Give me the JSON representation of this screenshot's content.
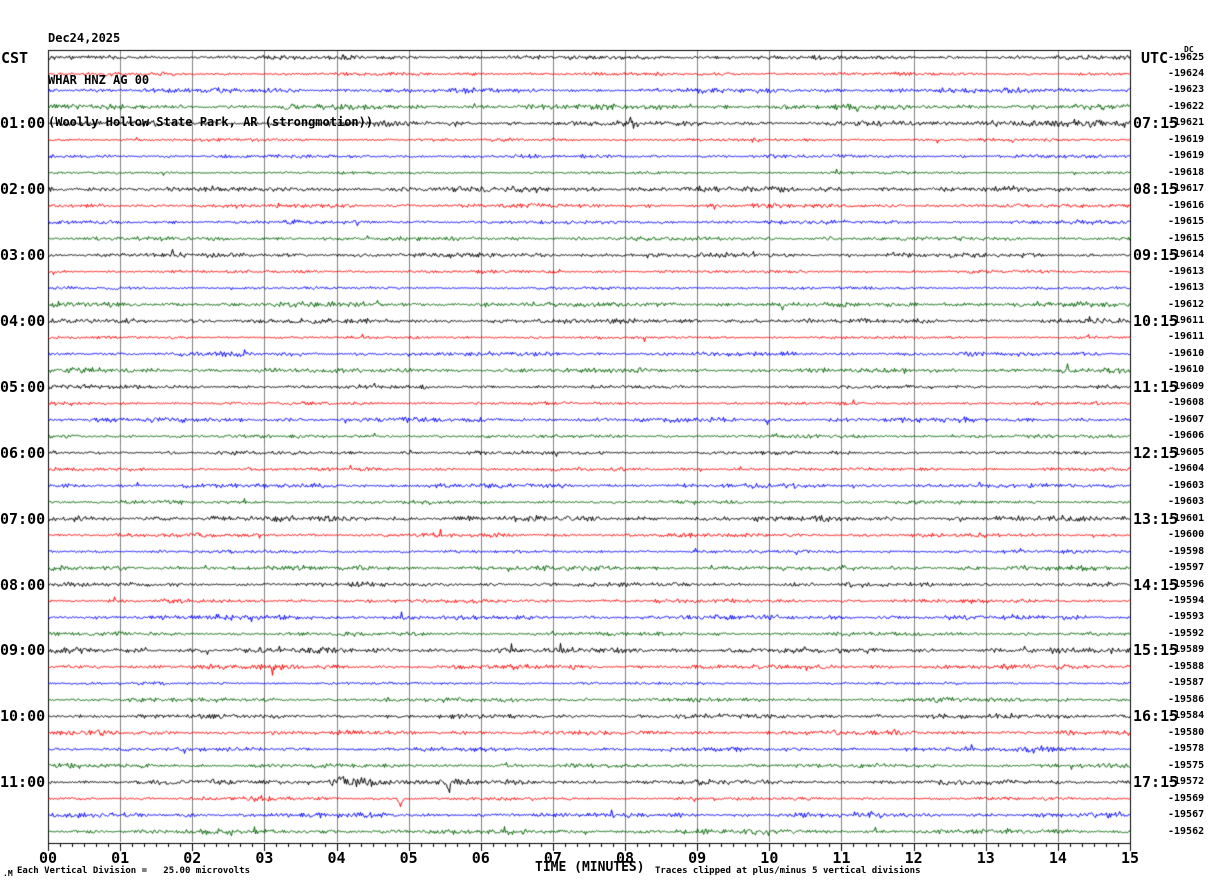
{
  "header": {
    "date": "Dec24,2025",
    "station": "WHAR HNZ AG 00",
    "location": "(Woolly Hollow State Park, AR (strongmotion))"
  },
  "axes": {
    "left_timezone": "CST",
    "right_timezone": "UTC",
    "dc_label": "DC",
    "xaxis_title": "TIME (MINUTES)"
  },
  "footer": {
    "corner_mark": ".M",
    "scale_note": "Each Vertical Division =   25.00 microvolts",
    "clip_note": "Traces clipped at plus/minus 5 vertical divisions"
  },
  "chart_data": {
    "type": "line",
    "title": "WHAR HNZ AG 00 helicorder, Dec24,2025, Woolly Hollow State Park, AR (strongmotion)",
    "xlabel": "TIME (MINUTES)",
    "x_range": [
      0,
      15
    ],
    "x_tick_labels": [
      "00",
      "01",
      "02",
      "03",
      "04",
      "05",
      "06",
      "07",
      "08",
      "09",
      "10",
      "11",
      "12",
      "13",
      "14",
      "15"
    ],
    "minor_ticks_per_minute": 6,
    "lines": 48,
    "minutes_per_line": 15,
    "line_colors_cycle": [
      "#000000",
      "#ff0000",
      "#0000ff",
      "#006400"
    ],
    "grid_color": "#808080",
    "border_color": "#000000",
    "left_hour_labels": [
      "01:00",
      "02:00",
      "03:00",
      "04:00",
      "05:00",
      "06:00",
      "07:00",
      "08:00",
      "09:00",
      "10:00",
      "11:00"
    ],
    "right_hour_labels": [
      "07:15",
      "08:15",
      "09:15",
      "10:15",
      "11:15",
      "12:15",
      "13:15",
      "14:15",
      "15:15",
      "16:15",
      "17:15"
    ],
    "dc_offsets": [
      -19625,
      -19624,
      -19623,
      -19622,
      -19621,
      -19619,
      -19619,
      -19618,
      -19617,
      -19616,
      -19615,
      -19615,
      -19614,
      -19613,
      -19613,
      -19612,
      -19611,
      -19611,
      -19610,
      -19610,
      -19609,
      -19608,
      -19607,
      -19606,
      -19605,
      -19604,
      -19603,
      -19603,
      -19601,
      -19600,
      -19598,
      -19597,
      -19596,
      -19594,
      -19593,
      -19592,
      -19589,
      -19588,
      -19587,
      -19586,
      -19584,
      -19580,
      -19578,
      -19575,
      -19572,
      -19569,
      -19567,
      -19562
    ],
    "vertical_division_microvolts": 25.0,
    "clip_divisions": 5,
    "events": [
      {
        "row": 4,
        "kind": "burst",
        "start": 12.2,
        "end": 14.9,
        "peak": 13.9,
        "amp": 3.2
      },
      {
        "row": 20,
        "kind": "burst",
        "start": 0.3,
        "end": 0.8,
        "peak": 0.55,
        "amp": 2.5
      },
      {
        "row": 42,
        "kind": "burst",
        "start": 13.2,
        "end": 14.4,
        "peak": 13.8,
        "amp": 2.8
      },
      {
        "row": 44,
        "kind": "burst",
        "start": 3.85,
        "end": 4.75,
        "peak": 4.2,
        "amp": 6.5
      },
      {
        "row": 44,
        "kind": "spike",
        "min": 5.55,
        "amp": 11,
        "dir": -1
      },
      {
        "row": 45,
        "kind": "spike",
        "min": 4.88,
        "amp": 9,
        "dir": -1
      },
      {
        "row": 45,
        "kind": "burst",
        "start": 2.7,
        "end": 3.5,
        "peak": 3.05,
        "amp": 2.2
      }
    ]
  }
}
